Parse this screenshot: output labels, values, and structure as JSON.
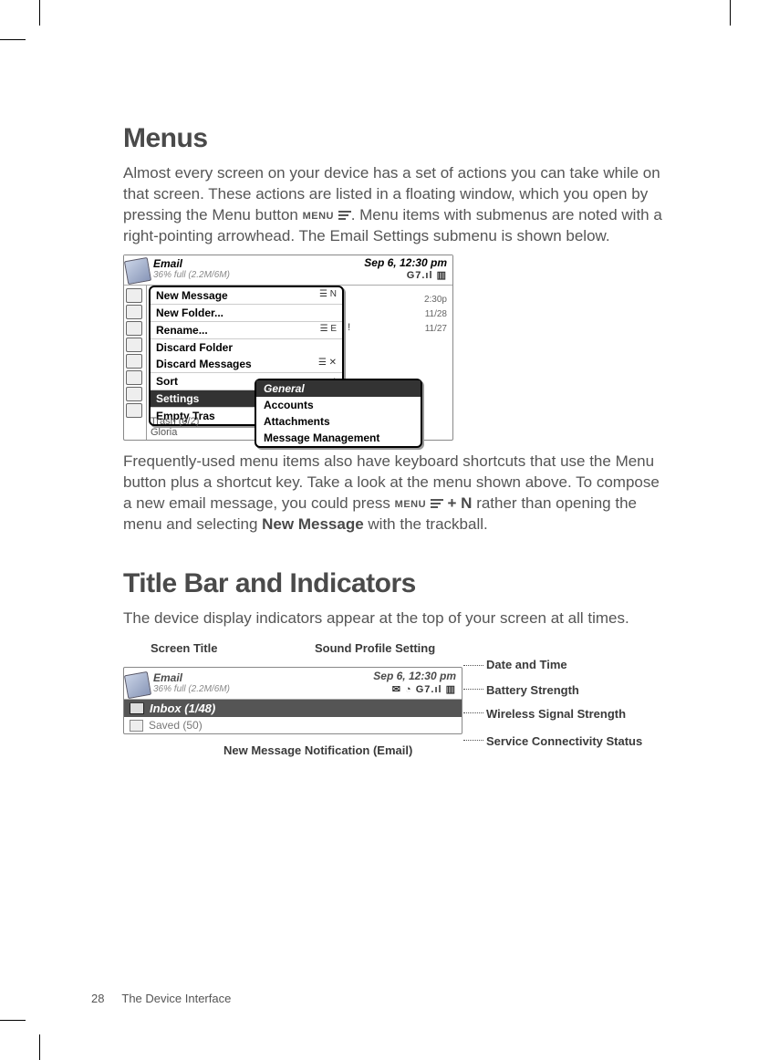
{
  "section1": {
    "heading": "Menus",
    "para1a": "Almost every screen on your device has a set of actions you can take while on that screen. These actions are listed in a floating window, which you open by pressing the Menu button ",
    "menu_label": "MENU",
    "para1b": ". Menu items with submenus are noted with a right-pointing arrowhead. The Email Settings submenu is shown below.",
    "para2a": "Frequently-used menu items also have keyboard shortcuts that use the Menu button plus a shortcut key. Take a look at the menu shown above. To compose a new email message, you could press ",
    "plus_n": "+ N",
    "para2b": " rather than opening the menu and selecting ",
    "new_message_bold": "New Message",
    "para2c": " with the trackball."
  },
  "shot1": {
    "app_title": "Email",
    "app_subtitle": "36% full (2.2M/6M)",
    "datetime": "Sep 6, 12:30 pm",
    "status_line": "G7.ıl  ▥",
    "menu_items": [
      {
        "label": "New Message",
        "shortcut": "☰ N"
      },
      {
        "label": "New Folder...",
        "shortcut": ""
      },
      {
        "label": "Rename...",
        "shortcut": "☰ E"
      },
      {
        "label": "Discard Folder",
        "shortcut": ""
      },
      {
        "label": "Discard Messages",
        "shortcut": "☰ ✕"
      },
      {
        "label": "Sort",
        "shortcut": "›"
      },
      {
        "label": "Settings",
        "shortcut": "›",
        "selected": true
      },
      {
        "label": "Empty Tras",
        "shortcut": ""
      }
    ],
    "submenu_items": [
      {
        "label": "General",
        "selected": true
      },
      {
        "label": "Accounts"
      },
      {
        "label": "Attachments"
      },
      {
        "label": "Message Management"
      }
    ],
    "bg_times": [
      "2:30p",
      "11/28",
      "11/27"
    ],
    "bg_hint": "t !",
    "bottom_rows": [
      "Trash (0/2)",
      "Gloria"
    ]
  },
  "section2": {
    "heading": "Title Bar and Indicators",
    "para": "The device display indicators appear at the top of your screen at all times."
  },
  "shot2": {
    "app_title": "Email",
    "app_subtitle": "36% full (2.2M/6M)",
    "datetime": "Sep 6, 12:30 pm",
    "icons_line": "✉ ◔ G7.ıl ▥",
    "inbox": "Inbox (1/48)",
    "saved": "Saved (50)"
  },
  "callouts": {
    "screen_title": "Screen Title",
    "sound_profile": "Sound Profile Setting",
    "date_time": "Date and Time",
    "battery": "Battery Strength",
    "signal": "Wireless Signal Strength",
    "service": "Service Connectivity Status",
    "new_msg": "New Message Notification (Email)"
  },
  "footer": {
    "page": "28",
    "chapter": "The Device Interface"
  }
}
